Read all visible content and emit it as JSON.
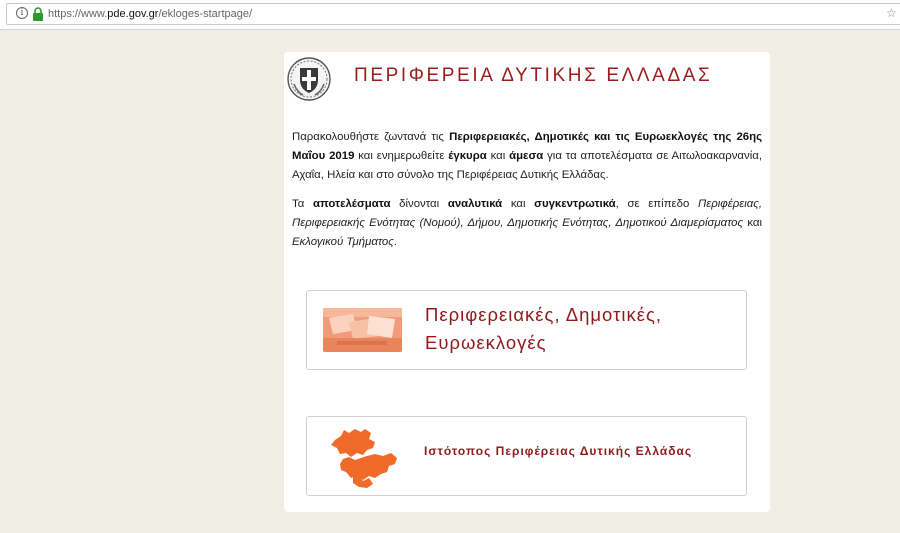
{
  "browser": {
    "url_scheme": "https://www.",
    "url_domain": "pde.gov.gr",
    "url_path": "/ekloges-startpage/"
  },
  "header": {
    "title": "ΠΕΡΙΦΕΡΕΙΑ ΔΥΤΙΚΗΣ ΕΛΛΑΔΑΣ"
  },
  "intro": {
    "p1_a": "Παρακολουθήστε ζωντανά τις ",
    "p1_b": "Περιφερειακές, Δημοτικές και τις Ευρωεκλογές της 26ης Μαΐου 2019",
    "p1_c": " και ενημερωθείτε ",
    "p1_d": "έγκυρα",
    "p1_e": " και ",
    "p1_f": "άμεσα",
    "p1_g": " για τα αποτελέσματα σε Αιτωλοακαρνανία, Αχαΐα, Ηλεία και στο σύνολο της Περιφέρειας Δυτικής Ελλάδας.",
    "p2_a": "Τα ",
    "p2_b": "αποτελέσματα",
    "p2_c": " δίνονται ",
    "p2_d": "αναλυτικά",
    "p2_e": " και ",
    "p2_f": "συγκεντρωτικά",
    "p2_g": ", σε επίπεδο ",
    "p2_h": "Περιφέρειας, Περιφερειακής Ενότητας (Νομού), Δήμου, Δημοτικής Ενότητας, Δημοτικού Διαμερίσματος",
    "p2_i": " και ",
    "p2_j": "Εκλογικού Τμήματος",
    "p2_k": "."
  },
  "links": {
    "elections_label": "Περιφερειακές, Δημοτικές, Ευρωεκλογές",
    "site_label": "Ιστότοπος Περιφέρειας Δυτικής Ελλάδας"
  },
  "colors": {
    "accent": "#9b1c1c",
    "map_orange": "#f06a2a",
    "page_bg": "#f0ede4"
  }
}
